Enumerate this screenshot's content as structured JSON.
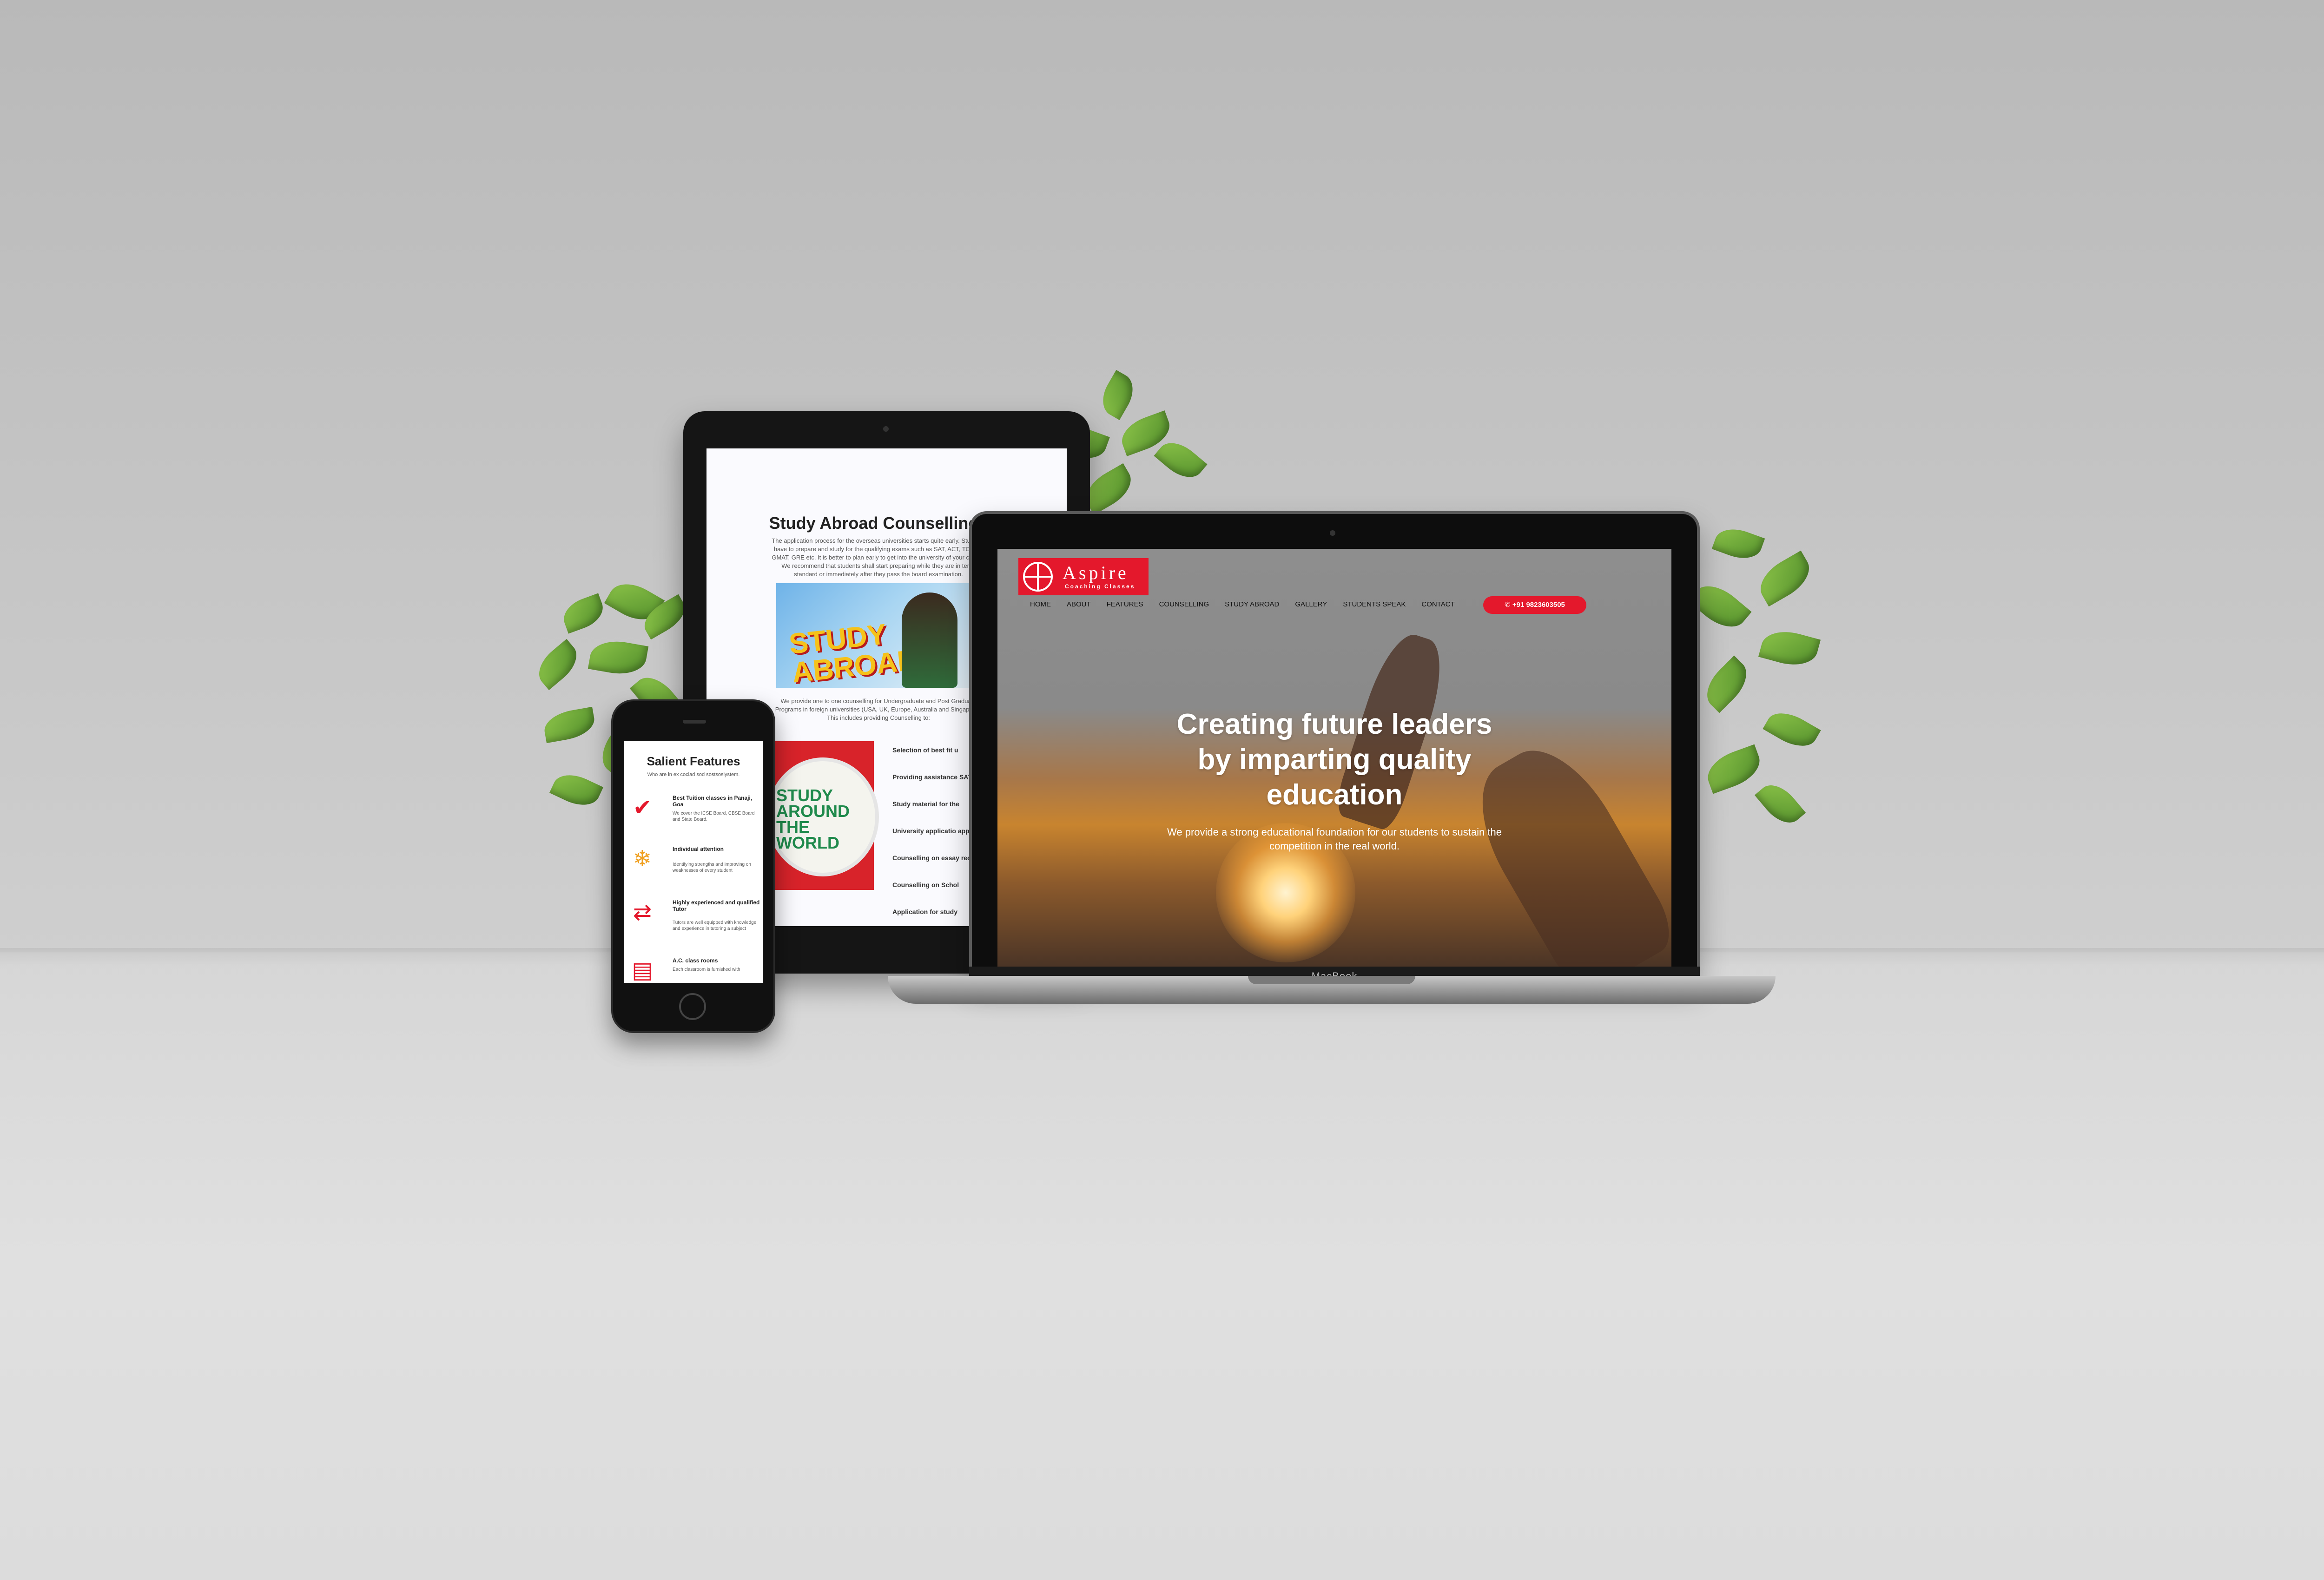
{
  "tablet": {
    "title": "Study Abroad Counselling",
    "intro": "The application process for the overseas universities starts quite early. Students have to prepare and study for the qualifying exams such as SAT, ACT, TOEFL, GMAT, GRE etc. It is better to plan early to get into the university of your choice. We recommend that students shall start preparing while they are in tenth standard or immediately after they pass the board examination.",
    "image1_text": "STUDY ABROAD",
    "intro2": "We provide one to one counselling for Undergraduate and Post Graduate Programs in foreign universities (USA, UK, Europe, Australia and Singapore). This includes providing Counselling to:",
    "image2_text": "STUDY AROUND THE WORLD",
    "list": [
      "Selection of best fit u",
      "Providing assistance SAT, TOEFL, GMAT, GR",
      "Study material for the",
      "University applicatio applications)",
      "Counselling on essay recommendation lett",
      "Counselling on Schol",
      "Application for study"
    ]
  },
  "laptop": {
    "logo_name": "Aspire",
    "logo_sub": "Coaching Classes",
    "nav": [
      "HOME",
      "ABOUT",
      "FEATURES",
      "COUNSELLING",
      "STUDY ABROAD",
      "GALLERY",
      "STUDENTS SPEAK",
      "CONTACT"
    ],
    "phone_button": "+91 9823603505",
    "hero_title": "Creating future leaders by imparting quality education",
    "hero_sub": "We provide a strong educational foundation for our students to sustain the competition in the real world.",
    "brand": "MacBook"
  },
  "phone": {
    "title": "Salient Features",
    "sub": "Who are in ex cociad sod sostsoslystem.",
    "items": [
      {
        "icon": "check-icon",
        "heading": "Best Tuition classes in Panaji, Goa",
        "desc": "We cover the ICSE Board, CBSE Board and State Board."
      },
      {
        "icon": "snowflake-icon",
        "heading": "Individual attention",
        "desc": "Identifying strengths and improving on weaknesses of every student"
      },
      {
        "icon": "arrows-icon",
        "heading": "Highly experienced and qualified Tutor",
        "desc": "Tutors are well equipped with knowledge and experience in tutoring a subject"
      },
      {
        "icon": "certificate-icon",
        "heading": "A.C. class rooms",
        "desc": "Each classroom is furnished with"
      }
    ]
  },
  "colors": {
    "accent": "#e4182c",
    "leaf": "#6aa83a"
  }
}
